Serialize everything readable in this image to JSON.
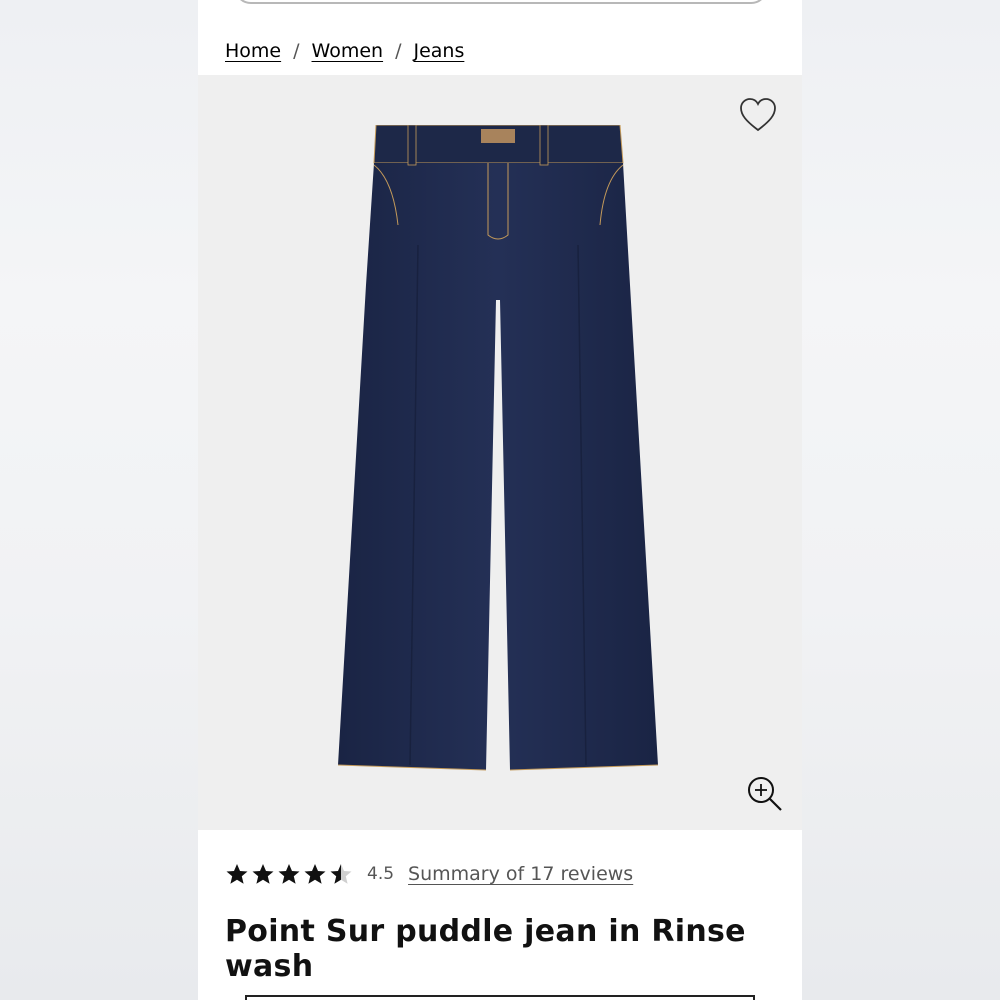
{
  "breadcrumb": {
    "items": [
      "Home",
      "Women",
      "Jeans"
    ],
    "separator": "/"
  },
  "hero": {
    "background": "#efefef",
    "wishlist_icon": "heart-outline-icon",
    "zoom_icon": "zoom-in-icon"
  },
  "product": {
    "title": "Point Sur puddle jean in Rinse wash",
    "rating_value": "4.5",
    "rating_stars": 4.5,
    "reviews_link": "Summary of 17 reviews",
    "denim_color": "#1f2a4a"
  }
}
